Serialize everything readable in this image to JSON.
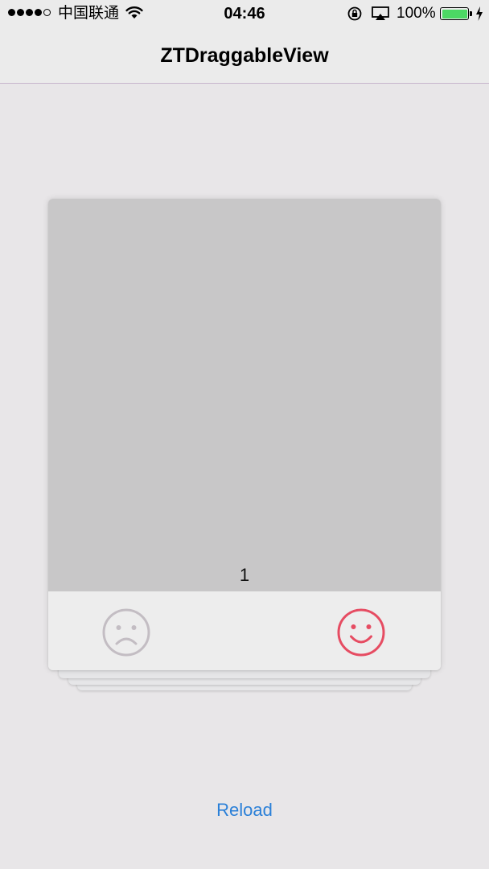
{
  "status_bar": {
    "carrier": "中国联通",
    "time": "04:46",
    "battery_percent": "100%",
    "battery_level": 1.0,
    "icons": [
      "signal-dots",
      "wifi-icon",
      "rotation-lock-icon",
      "airplay-icon",
      "battery-icon",
      "charging-bolt-icon"
    ]
  },
  "nav": {
    "title": "ZTDraggableView"
  },
  "card": {
    "number": "1",
    "dislike_icon": "sad-face-icon",
    "like_icon": "smile-face-icon"
  },
  "reload_label": "Reload",
  "colors": {
    "background": "#e8e6e8",
    "card_photo": "#c8c7c8",
    "dislike": "#c3bdc3",
    "like": "#e64c62",
    "link": "#2b80d8",
    "battery": "#4cd964"
  }
}
